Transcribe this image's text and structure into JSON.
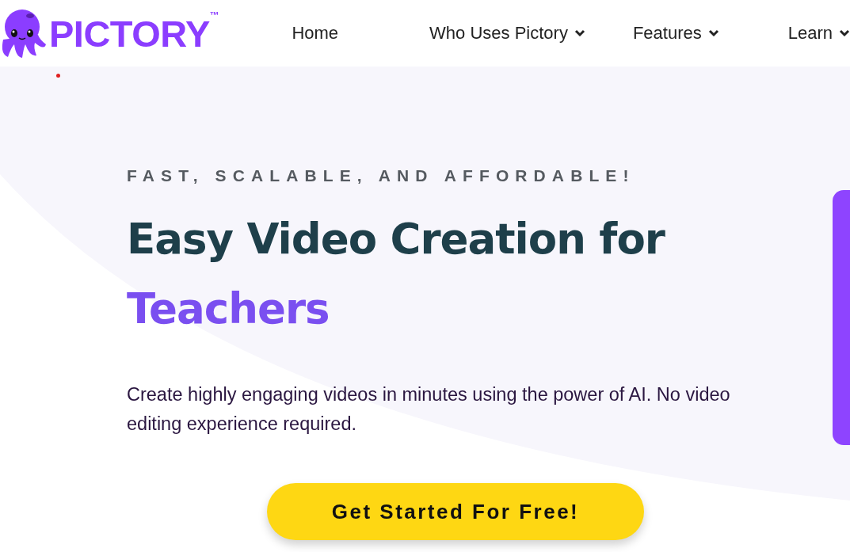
{
  "logo": {
    "name": "PICTORY",
    "trademark": "™"
  },
  "nav": [
    {
      "label": "Home",
      "dropdown": false
    },
    {
      "label": "Who Uses Pictory",
      "dropdown": true
    },
    {
      "label": "Features",
      "dropdown": true
    },
    {
      "label": "Learn",
      "dropdown": true
    }
  ],
  "hero": {
    "eyebrow": "FAST, SCALABLE, AND AFFORDABLE!",
    "title": "Easy Video Creation for",
    "highlight": "Teachers",
    "description": "Create highly engaging videos in minutes using the power of AI. No video editing experience required.",
    "cta": "Get Started For Free!"
  }
}
